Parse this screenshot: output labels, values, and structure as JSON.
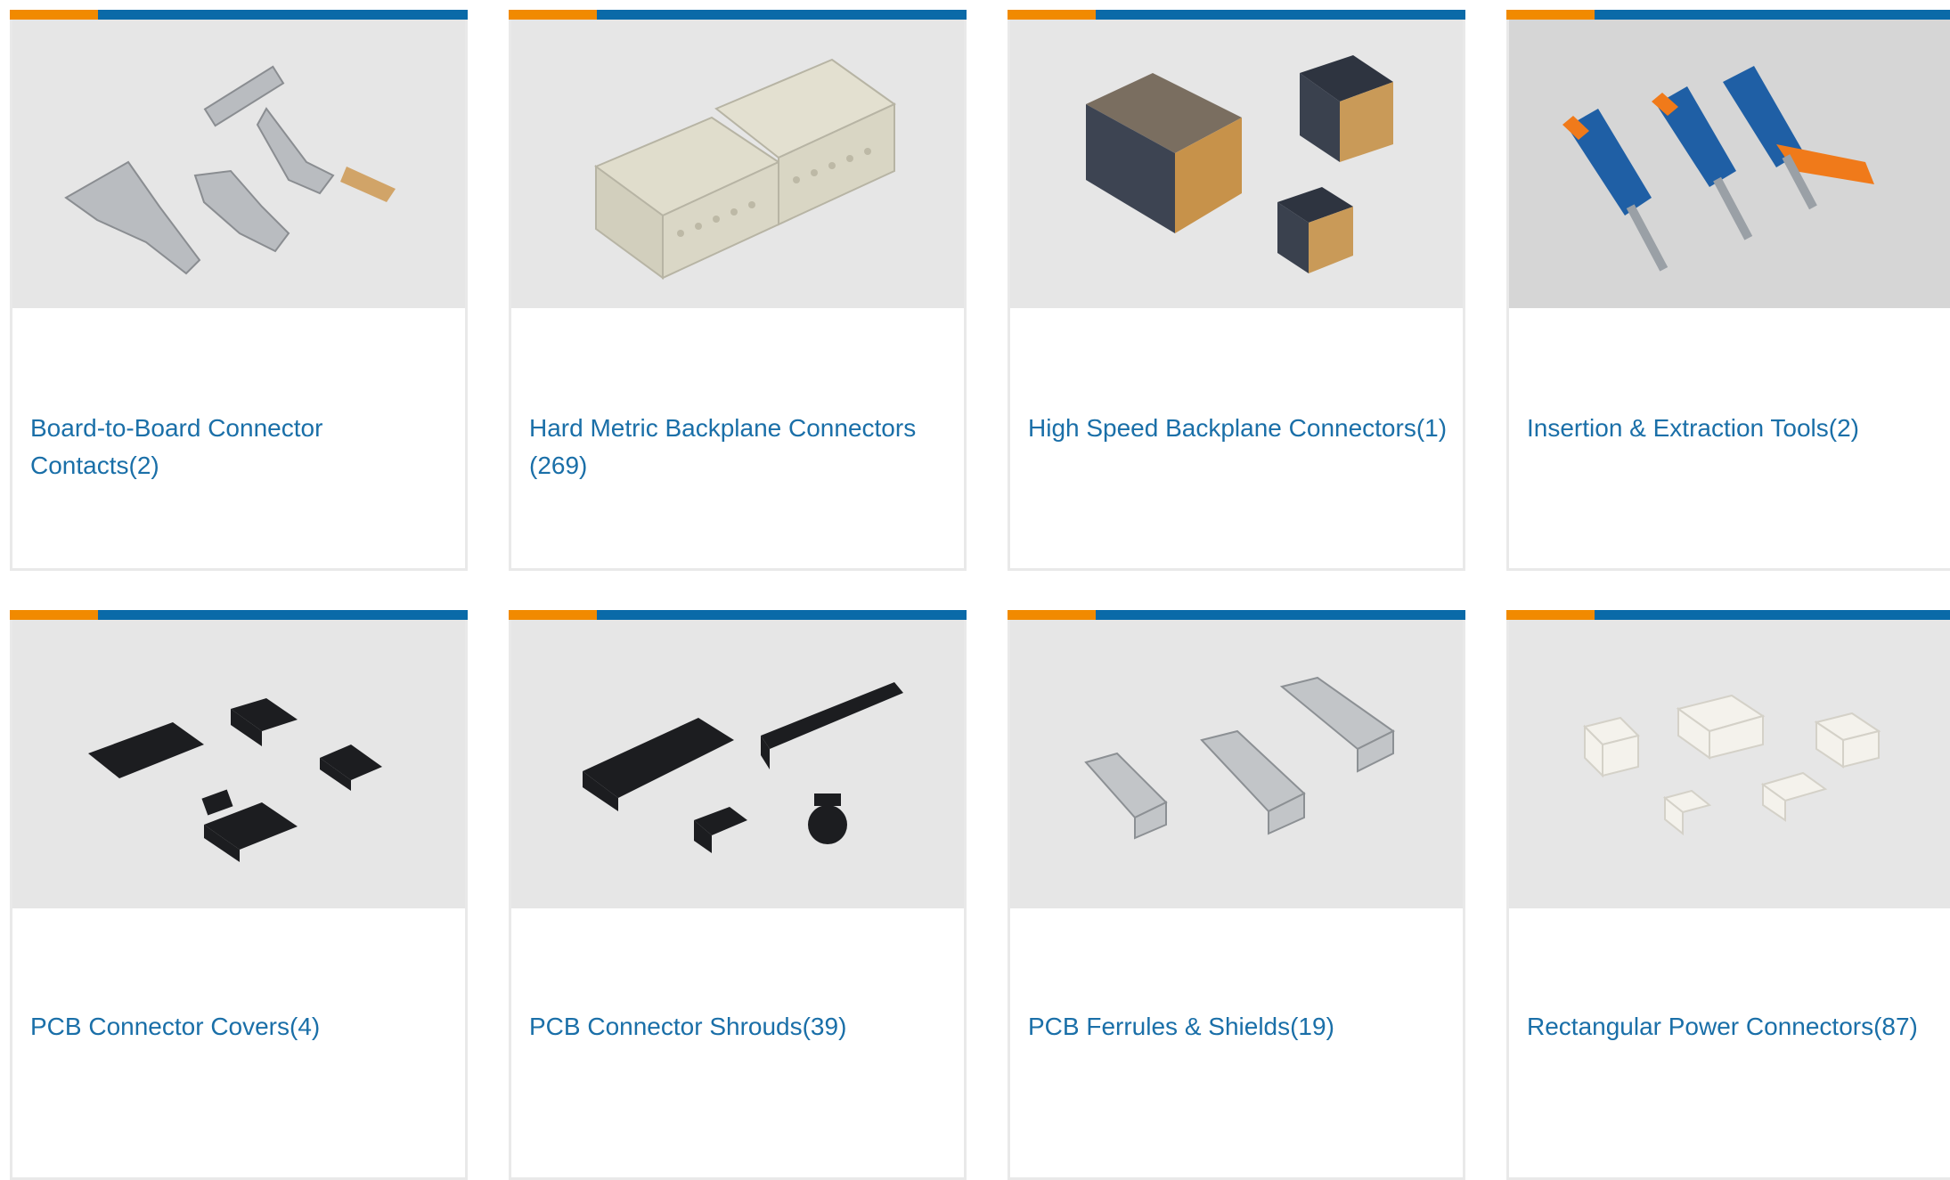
{
  "categories": [
    {
      "label": "Board-to-Board Connector Contacts(2)",
      "icon": "contacts-icon"
    },
    {
      "label": "Hard Metric Backplane Connectors (269)",
      "icon": "hard-metric-connector-icon"
    },
    {
      "label": "High Speed Backplane Connectors(1)",
      "icon": "high-speed-connector-icon"
    },
    {
      "label": "Insertion & Extraction Tools(2)",
      "icon": "insertion-tool-icon"
    },
    {
      "label": "PCB Connector Covers(4)",
      "icon": "covers-icon"
    },
    {
      "label": "PCB Connector Shrouds(39)",
      "icon": "shrouds-icon"
    },
    {
      "label": "PCB Ferrules & Shields(19)",
      "icon": "ferrules-shields-icon"
    },
    {
      "label": "Rectangular Power Connectors(87)",
      "icon": "power-connector-icon"
    }
  ],
  "colors": {
    "accent_orange": "#f18a00",
    "accent_blue": "#0a6aa8",
    "link": "#1a6fa8",
    "image_bg": "#e6e6e6",
    "card_border": "#e9e9e9"
  }
}
